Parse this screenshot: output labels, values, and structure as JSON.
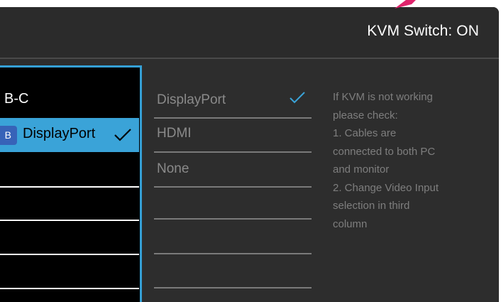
{
  "header": {
    "kvm_status": "KVM Switch: ON"
  },
  "left_column": {
    "items": [
      {
        "label": "B-C"
      },
      {
        "tag": "B",
        "label": "DisplayPort",
        "selected": true
      }
    ]
  },
  "middle_column": {
    "items": [
      {
        "label": "DisplayPort",
        "checked": true
      },
      {
        "label": "HDMI",
        "checked": false
      },
      {
        "label": "None",
        "checked": false
      }
    ]
  },
  "info": {
    "lines": [
      "If KVM is not working",
      "please check:",
      "1. Cables are",
      "connected to both PC",
      "and monitor",
      "2. Change Video Input",
      "selection in third",
      "column"
    ]
  },
  "colors": {
    "accent": "#3aa3d8",
    "tag": "#3763b8",
    "pointer": "#e0246c",
    "panel": "#2d2d2d"
  },
  "icons": [
    "check-icon",
    "pointer-marker"
  ]
}
